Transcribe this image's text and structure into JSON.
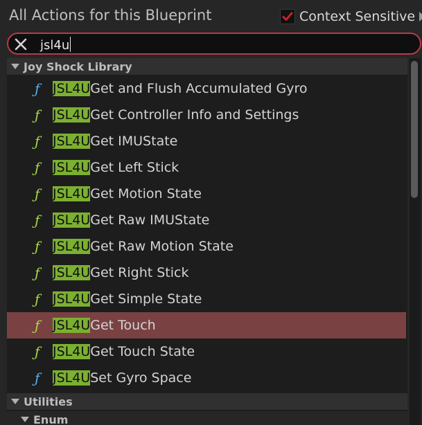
{
  "header": {
    "title": "All Actions for this Blueprint",
    "context_sensitive_label": "Context Sensitive",
    "context_sensitive_checked": true,
    "checkmark_color": "#d4202c"
  },
  "search": {
    "value": "jsl4u",
    "clear_icon": "close-icon"
  },
  "categories": [
    {
      "label": "Joy Shock Library",
      "expanded": true,
      "items": [
        {
          "prefix": "JSL4U",
          "rest": "Get and Flush Accumulated Gyro",
          "icon": "function-icon",
          "icon_color": "blue"
        },
        {
          "prefix": "JSL4U",
          "rest": "Get Controller Info and Settings",
          "icon": "function-icon",
          "icon_color": "green"
        },
        {
          "prefix": "JSL4U",
          "rest": "Get IMUState",
          "icon": "function-icon",
          "icon_color": "green"
        },
        {
          "prefix": "JSL4U",
          "rest": "Get Left Stick",
          "icon": "function-icon",
          "icon_color": "green"
        },
        {
          "prefix": "JSL4U",
          "rest": "Get Motion State",
          "icon": "function-icon",
          "icon_color": "green"
        },
        {
          "prefix": "JSL4U",
          "rest": "Get Raw IMUState",
          "icon": "function-icon",
          "icon_color": "green"
        },
        {
          "prefix": "JSL4U",
          "rest": "Get Raw Motion State",
          "icon": "function-icon",
          "icon_color": "green"
        },
        {
          "prefix": "JSL4U",
          "rest": "Get Right Stick",
          "icon": "function-icon",
          "icon_color": "green"
        },
        {
          "prefix": "JSL4U",
          "rest": "Get Simple State",
          "icon": "function-icon",
          "icon_color": "green"
        },
        {
          "prefix": "JSL4U",
          "rest": "Get Touch",
          "icon": "function-icon",
          "icon_color": "green",
          "selected": true
        },
        {
          "prefix": "JSL4U",
          "rest": "Get Touch State",
          "icon": "function-icon",
          "icon_color": "green"
        },
        {
          "prefix": "JSL4U",
          "rest": "Set Gyro Space",
          "icon": "function-icon",
          "icon_color": "blue"
        }
      ]
    },
    {
      "label": "Utilities",
      "expanded": true
    },
    {
      "label": "Enum",
      "expanded": true
    }
  ],
  "colors": {
    "highlight": "#7bb030",
    "selected_row": "#7a4142",
    "search_border": "#b93a48"
  }
}
